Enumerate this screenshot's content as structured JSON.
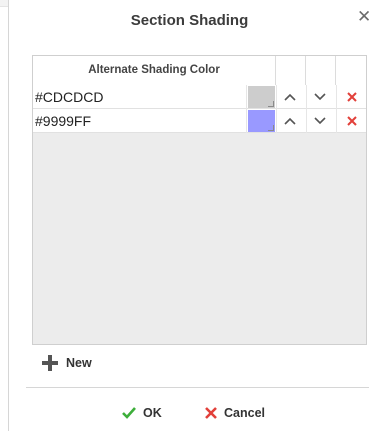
{
  "dialog": {
    "title": "Section Shading",
    "close_glyph": "✕"
  },
  "grid": {
    "column_header": "Alternate Shading Color",
    "rows": [
      {
        "value": "#CDCDCD",
        "swatch_color": "#CDCDCD"
      },
      {
        "value": "#9999FF",
        "swatch_color": "#9999FF"
      }
    ]
  },
  "actions": {
    "new_label": "New",
    "ok_label": "OK",
    "cancel_label": "Cancel"
  },
  "icons": {
    "move_up": "chevron-up-icon",
    "move_down": "chevron-down-icon",
    "delete": "red-x-icon",
    "add": "plus-icon",
    "ok": "green-check-icon",
    "cancel": "red-x-icon"
  },
  "colors": {
    "delete_red": "#E2403A",
    "cancel_red": "#E2403A",
    "ok_green": "#3DAE3A"
  }
}
